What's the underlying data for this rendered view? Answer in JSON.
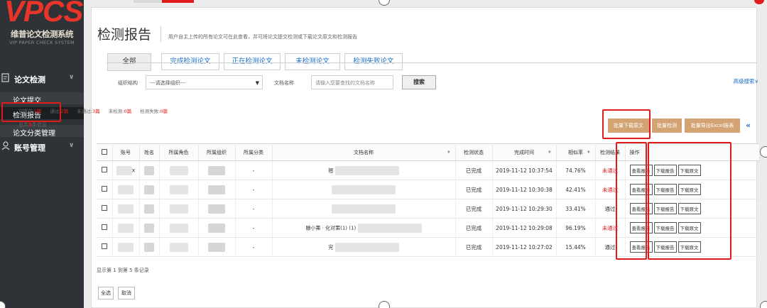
{
  "brand": {
    "logo_text": "VPCS",
    "name_cn": "维普论文检测系统",
    "name_en": "VIP PAPER CHECK SYSTEM",
    "accent": "#e9342a"
  },
  "sidebar": {
    "sections": [
      {
        "label": "论文检测",
        "icon": "document-icon",
        "expanded": true
      },
      {
        "label": "账号管理",
        "icon": "user-icon",
        "expanded": false
      }
    ],
    "items": [
      {
        "label": "论文提交"
      },
      {
        "label": "检测报告",
        "active": true
      },
      {
        "label": "论文分类管理"
      }
    ]
  },
  "page": {
    "title": "检测报告",
    "subtitle": "用户自主上传的所有论文可在此查看，并可将论文提交检测或下载论文原文和检测报告"
  },
  "tabs": [
    {
      "label": "全部",
      "active": true
    },
    {
      "label": "完成检测论文"
    },
    {
      "label": "正在检测论文"
    },
    {
      "label": "未检测论文"
    },
    {
      "label": "检测失败论文"
    }
  ],
  "filters": {
    "org_label": "组织结构",
    "org_value": "---请选择组织---",
    "doc_label": "文档名称",
    "doc_placeholder": "请输入您要查找的文档名称",
    "search_label": "搜索",
    "advanced_label": "高级搜索"
  },
  "stats": {
    "submitted_label": "已提交:",
    "submitted": "5篇",
    "passed_label": "通过:",
    "passed": "2篇",
    "failed_label": "未通过:",
    "failed": "3篇",
    "unchecked_label": "未检测:",
    "unchecked": "0篇",
    "checkfail_label": "检测失败:",
    "checkfail": "0篇",
    "total_prefix": "总共",
    "total_count": "5",
    "total_suffix": "条信息"
  },
  "actions": {
    "batch_download": "批量下载原文",
    "batch_check": "批量检测",
    "batch_export": "批量导出Excel报表",
    "collapse_icon": "double-chevron-left-icon",
    "button_color": "#d4a373"
  },
  "table": {
    "headers": [
      "账号",
      "姓名",
      "所属角色",
      "所属组织",
      "所属分类",
      "文档名称",
      "检测状态",
      "完成时间",
      "相似率",
      "检测结果",
      "操作"
    ],
    "op_labels": [
      "查看报告",
      "下载报告",
      "下载原文"
    ],
    "rows": [
      {
        "account": "x",
        "category": "-",
        "doc": "翘",
        "status": "已完成",
        "time": "2019-11-12 10:37:54",
        "rate": "74.76%",
        "result": "未通过",
        "pass": false
      },
      {
        "account": "",
        "category": "-",
        "doc": "",
        "status": "已完成",
        "time": "2019-11-12 10:30:38",
        "rate": "42.41%",
        "result": "未通过",
        "pass": false
      },
      {
        "account": "",
        "category": "-",
        "doc": "",
        "status": "已完成",
        "time": "2019-11-12 10:29:30",
        "rate": "33.41%",
        "result": "通过",
        "pass": true
      },
      {
        "account": "",
        "category": "-",
        "doc": "滕小茀 ·  化对策(1) (1)",
        "status": "已完成",
        "time": "2019-11-12 10:29:08",
        "rate": "96.19%",
        "result": "未通过",
        "pass": false
      },
      {
        "account": "",
        "category": "-",
        "doc": "完",
        "status": "已完成",
        "time": "2019-11-12 10:27:02",
        "rate": "15.44%",
        "result": "通过",
        "pass": true
      }
    ]
  },
  "pagination": {
    "info": "显示第 1 到第 5 条记录",
    "select_all": "全选",
    "cancel": "取消"
  }
}
